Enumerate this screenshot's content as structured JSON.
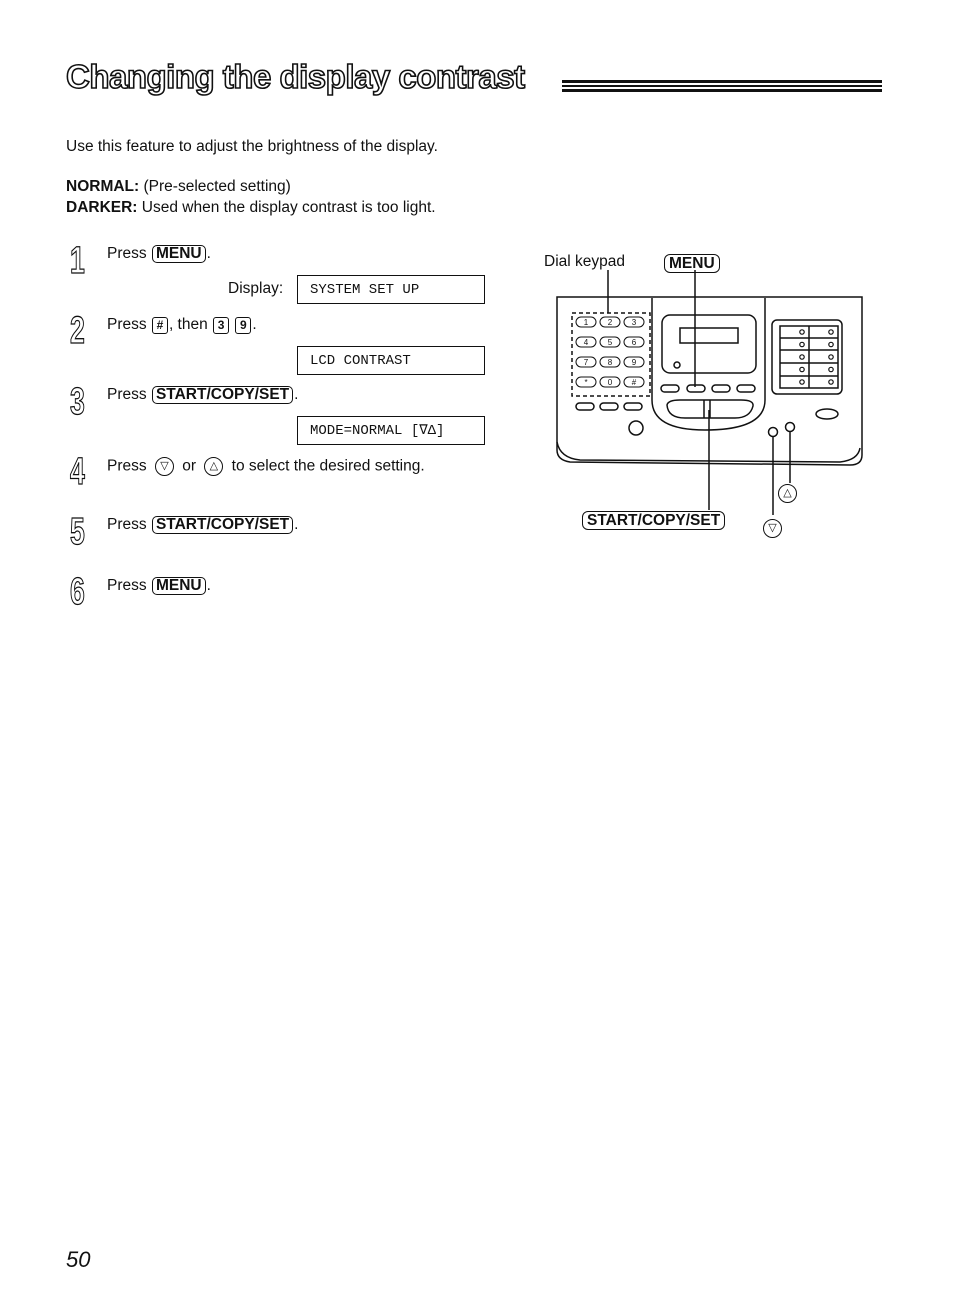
{
  "page": {
    "title": "Changing the display contrast",
    "intro": "Use this feature to adjust the brightness of the display.",
    "definitions": [
      {
        "term": "NORMAL:",
        "desc": "(Pre-selected setting)"
      },
      {
        "term": "DARKER:",
        "desc": "Used when the display contrast is too light."
      }
    ],
    "page_number": "50"
  },
  "steps": [
    {
      "num": "1",
      "press": "Press",
      "key": "MENU",
      "end": ".",
      "display_label": "Display:",
      "display": "SYSTEM SET UP"
    },
    {
      "num": "2",
      "press": "Press",
      "key1": "#",
      "then": ", then",
      "key2": "3",
      "key3": "9",
      "end": ".",
      "display": "LCD CONTRAST"
    },
    {
      "num": "3",
      "press": "Press",
      "key": "START/COPY/SET",
      "end": ".",
      "display": "MODE=NORMAL  [∇Δ]"
    },
    {
      "num": "4",
      "press": "Press",
      "key_down": "▽",
      "or": "or",
      "key_up": "△",
      "rest": "to select the desired setting."
    },
    {
      "num": "5",
      "press": "Press",
      "key": "START/COPY/SET",
      "end": "."
    },
    {
      "num": "6",
      "press": "Press",
      "key": "MENU",
      "end": "."
    }
  ],
  "diagram": {
    "label_keypad": "Dial keypad",
    "label_menu": "MENU",
    "label_start": "START/COPY/SET",
    "label_up": "△",
    "label_down": "▽",
    "keypad_keys": [
      "1",
      "2",
      "3",
      "4",
      "5",
      "6",
      "7",
      "8",
      "9",
      "*",
      "0",
      "#"
    ]
  }
}
